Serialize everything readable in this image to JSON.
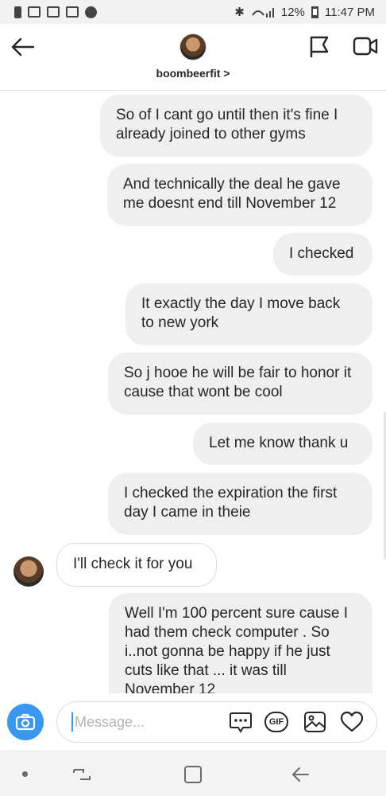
{
  "status_bar": {
    "battery_percent": "12%",
    "time": "11:47 PM"
  },
  "header": {
    "username": "boombeerfit",
    "chevron": ">"
  },
  "messages": [
    {
      "direction": "outgoing",
      "text": "So of I cant go until then it's fine I already joined to other gyms"
    },
    {
      "direction": "outgoing",
      "text": "And technically the deal he gave me doesnt end till November 12"
    },
    {
      "direction": "outgoing",
      "text": "I checked"
    },
    {
      "direction": "outgoing",
      "text": "It exactly the day I move back to new york"
    },
    {
      "direction": "outgoing",
      "text": "So j hooe he will be fair to honor it cause that wont be cool"
    },
    {
      "direction": "outgoing",
      "text": "Let me know thank u"
    },
    {
      "direction": "outgoing",
      "text": "I checked the expiration the first day I came in theie"
    },
    {
      "direction": "incoming",
      "text": "I'll check it for you"
    },
    {
      "direction": "outgoing",
      "text": "Well I'm 100 percent sure cause I had them check computer . So i..not gonna be happy if he just cuts like that ... it was till November 12"
    }
  ],
  "composer": {
    "placeholder": "Message...",
    "value": ""
  },
  "icons": {
    "back": "back-arrow-icon",
    "flag": "flag-icon",
    "video": "video-call-icon",
    "camera": "camera-icon",
    "sticker": "sticker-icon",
    "gif": "GIF",
    "image": "gallery-icon",
    "like": "heart-icon"
  },
  "colors": {
    "accent": "#3897f0",
    "outgoing_bubble": "#efefef",
    "incoming_border": "#dbdbdb"
  }
}
